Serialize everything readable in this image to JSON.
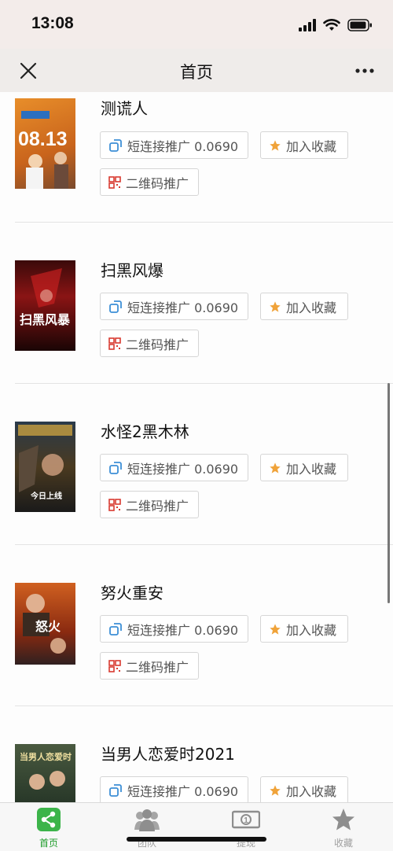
{
  "status_bar": {
    "time": "13:08"
  },
  "nav": {
    "title": "首页"
  },
  "items": [
    {
      "title": "测谎人",
      "link_label": "短连接推广 0.0690",
      "fav_label": "加入收藏",
      "qr_label": "二维码推广"
    },
    {
      "title": "扫黑风爆",
      "link_label": "短连接推广 0.0690",
      "fav_label": "加入收藏",
      "qr_label": "二维码推广"
    },
    {
      "title": "水怪2黑木林",
      "link_label": "短连接推广 0.0690",
      "fav_label": "加入收藏",
      "qr_label": "二维码推广"
    },
    {
      "title": "努火重安",
      "link_label": "短连接推广 0.0690",
      "fav_label": "加入收藏",
      "qr_label": "二维码推广"
    },
    {
      "title": "当男人恋爱时2021",
      "link_label": "短连接推广 0.0690",
      "fav_label": "加入收藏"
    }
  ],
  "posters": [
    {
      "text": "08.13"
    },
    {
      "text": "扫黑风暴"
    },
    {
      "text": "今日上线"
    },
    {
      "text": "怒火"
    },
    {
      "text": "当男人恋爱时"
    }
  ],
  "tabs": [
    {
      "label": "首页",
      "icon": "share-icon",
      "active": true
    },
    {
      "label": "团队",
      "icon": "team-icon",
      "active": false
    },
    {
      "label": "提现",
      "icon": "cash-icon",
      "active": false
    },
    {
      "label": "收藏",
      "icon": "star-icon",
      "active": false
    }
  ],
  "colors": {
    "accent_green": "#1e9c2a",
    "star_orange": "#f0a33a",
    "qr_red": "#d93a30",
    "link_blue": "#3d8fd6"
  }
}
